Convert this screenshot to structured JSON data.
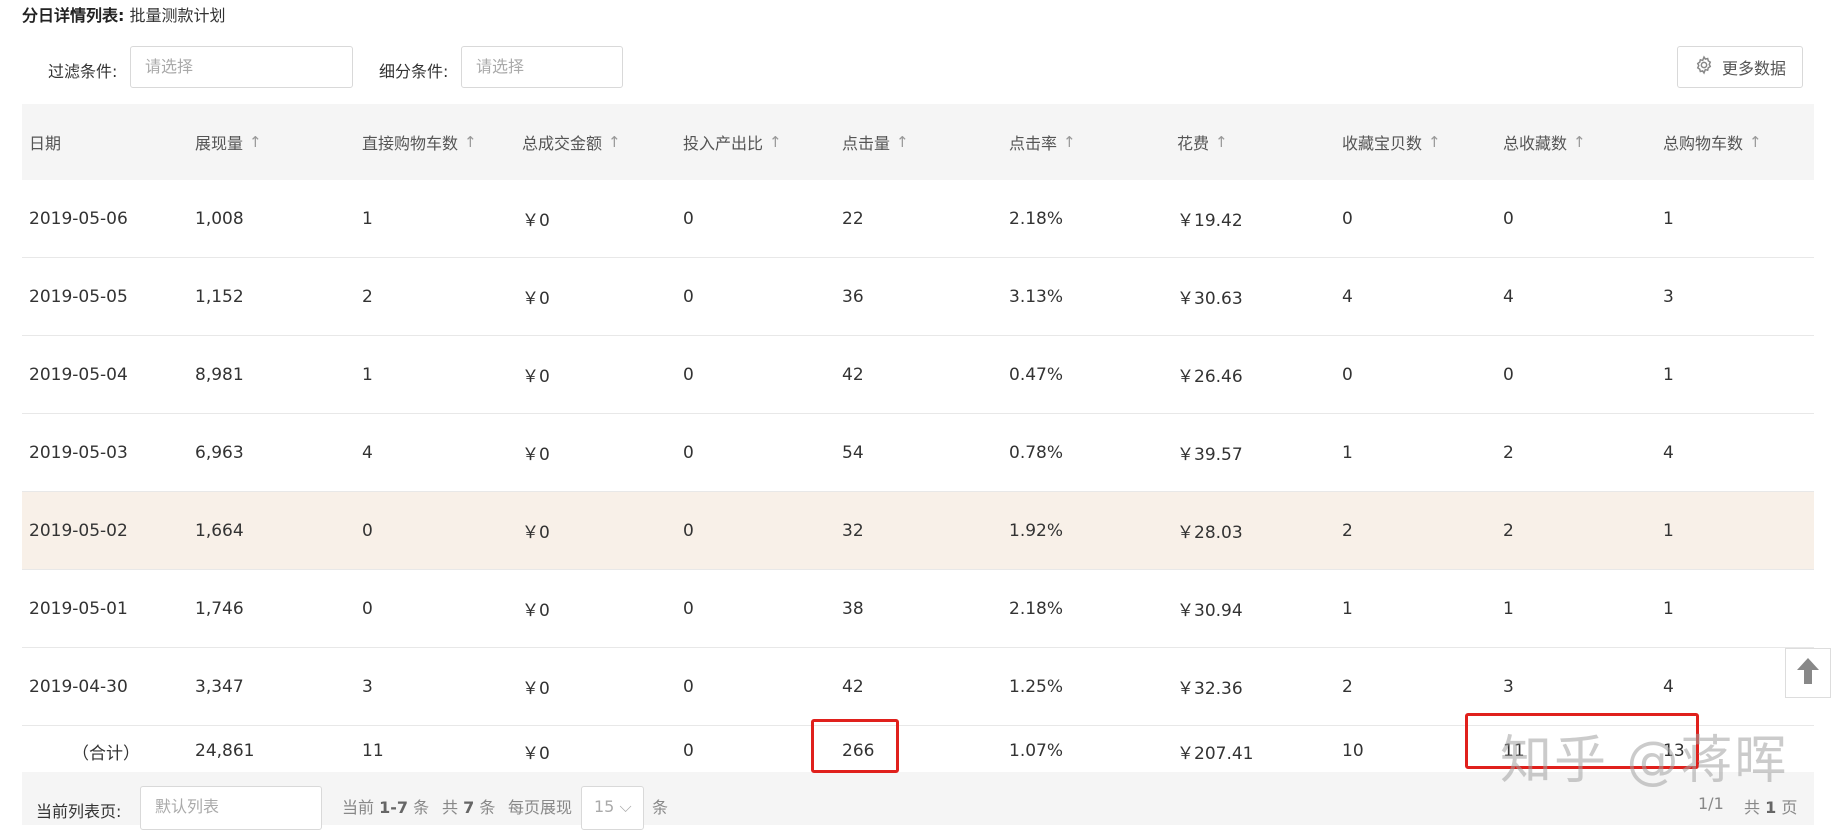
{
  "header": {
    "title": "分日详情列表:",
    "plan": "批量测款计划"
  },
  "filters": {
    "filter_label": "过滤条件:",
    "filter_placeholder": "请选择",
    "segment_label": "细分条件:",
    "segment_placeholder": "请选择",
    "more_data_label": "更多数据",
    "more_data_icon": "gear-icon"
  },
  "table": {
    "sort_arrow": "↑",
    "columns": [
      {
        "label": "日期",
        "sortable": false
      },
      {
        "label": "展现量",
        "sortable": true
      },
      {
        "label": "直接购物车数",
        "sortable": true
      },
      {
        "label": "总成交金额",
        "sortable": true
      },
      {
        "label": "投入产出比",
        "sortable": true
      },
      {
        "label": "点击量",
        "sortable": true
      },
      {
        "label": "点击率",
        "sortable": true
      },
      {
        "label": "花费",
        "sortable": true
      },
      {
        "label": "收藏宝贝数",
        "sortable": true
      },
      {
        "label": "总收藏数",
        "sortable": true
      },
      {
        "label": "总购物车数",
        "sortable": true
      }
    ],
    "rows": [
      [
        "2019-05-06",
        "1,008",
        "1",
        "￥0",
        "0",
        "22",
        "2.18%",
        "￥19.42",
        "0",
        "0",
        "1"
      ],
      [
        "2019-05-05",
        "1,152",
        "2",
        "￥0",
        "0",
        "36",
        "3.13%",
        "￥30.63",
        "4",
        "4",
        "3"
      ],
      [
        "2019-05-04",
        "8,981",
        "1",
        "￥0",
        "0",
        "42",
        "0.47%",
        "￥26.46",
        "0",
        "0",
        "1"
      ],
      [
        "2019-05-03",
        "6,963",
        "4",
        "￥0",
        "0",
        "54",
        "0.78%",
        "￥39.57",
        "1",
        "2",
        "4"
      ],
      [
        "2019-05-02",
        "1,664",
        "0",
        "￥0",
        "0",
        "32",
        "1.92%",
        "￥28.03",
        "2",
        "2",
        "1"
      ],
      [
        "2019-05-01",
        "1,746",
        "0",
        "￥0",
        "0",
        "38",
        "2.18%",
        "￥30.94",
        "1",
        "1",
        "1"
      ],
      [
        "2019-04-30",
        "3,347",
        "3",
        "￥0",
        "0",
        "42",
        "1.25%",
        "￥32.36",
        "2",
        "3",
        "4"
      ]
    ],
    "highlighted_row": 4,
    "total": [
      "（合计）",
      "24,861",
      "11",
      "￥0",
      "0",
      "266",
      "1.07%",
      "￥207.41",
      "10",
      "11",
      "13"
    ]
  },
  "footer": {
    "page_label": "当前列表页:",
    "page_placeholder": "默认列表",
    "current_prefix": "当前",
    "current_range": "1-7",
    "current_suffix": "条",
    "total_prefix": "共",
    "total_count": "7",
    "total_suffix": "条",
    "per_page_label": "每页展现",
    "per_page_value": "15",
    "per_page_suffix": "条",
    "page_indicator": "1/1",
    "pages_prefix": "共",
    "pages_count": "1",
    "pages_suffix": "页"
  },
  "watermark": "知乎 @蒋晖",
  "colors": {
    "highlight_row": "#f8f0e8",
    "annotation_red": "#e0201c",
    "header_bg": "#f5f5f5"
  }
}
